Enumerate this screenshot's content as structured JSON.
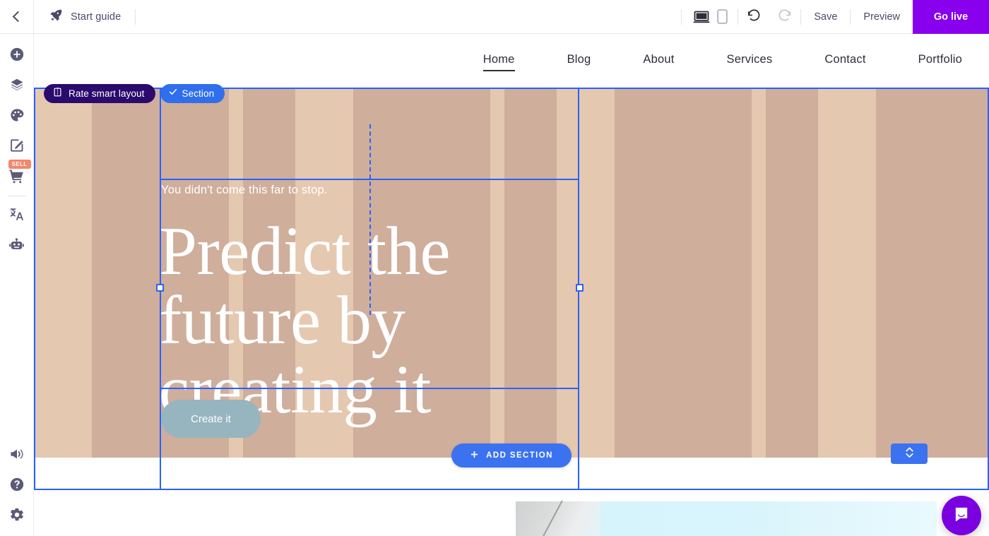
{
  "topbar": {
    "back_icon": "chevron-left-icon",
    "start_guide_label": "Start guide",
    "start_guide_icon": "rocket-icon",
    "desktop_icon": "desktop-monitor-icon",
    "mobile_icon": "mobile-phone-icon",
    "undo_icon": "undo-arrow-icon",
    "redo_icon": "redo-arrow-icon",
    "save_label": "Save",
    "preview_label": "Preview",
    "golive_label": "Go live",
    "golive_color": "#8800ee"
  },
  "sidebar": {
    "items": [
      {
        "name": "add",
        "icon": "plus-circle-icon"
      },
      {
        "name": "layers",
        "icon": "layers-icon"
      },
      {
        "name": "design",
        "icon": "palette-icon"
      },
      {
        "name": "edit",
        "icon": "edit-square-icon"
      },
      {
        "name": "store",
        "icon": "shopping-cart-icon",
        "badge": "SELL",
        "badge_color": "#f4866a"
      },
      {
        "name": "translate",
        "icon": "translate-icon"
      },
      {
        "name": "assistant",
        "icon": "robot-icon"
      }
    ],
    "bottom_items": [
      {
        "name": "announcements",
        "icon": "megaphone-icon"
      },
      {
        "name": "help",
        "icon": "question-circle-icon"
      },
      {
        "name": "settings",
        "icon": "gear-icon"
      }
    ]
  },
  "site": {
    "nav": [
      {
        "label": "Home",
        "active": true
      },
      {
        "label": "Blog",
        "active": false
      },
      {
        "label": "About",
        "active": false
      },
      {
        "label": "Services",
        "active": false
      },
      {
        "label": "Contact",
        "active": false
      },
      {
        "label": "Portfolio",
        "active": false
      }
    ],
    "hero": {
      "tagline": "You didn't come this far to stop.",
      "headline": "Predict the future by creating it",
      "cta_label": "Create it",
      "cta_color": "#96b5bf",
      "stripe_light": "#e5c8b0",
      "stripe_dark": "#cfae9c"
    }
  },
  "editor": {
    "badge_rate_label": "Rate smart layout",
    "badge_rate_icon": "smart-layout-icon",
    "badge_rate_color": "#2b0a6e",
    "badge_section_label": "Section",
    "badge_section_icon": "check-icon",
    "badge_section_color": "#2f6fed",
    "add_section_label": "ADD SECTION",
    "add_section_icon": "plus-icon",
    "add_section_color": "#3b72f0",
    "move_control_icon": "chevron-up-down-icon",
    "chat_icon": "chat-bubble-icon",
    "chat_color": "#7a00e0",
    "selection_color": "#2962ff"
  }
}
